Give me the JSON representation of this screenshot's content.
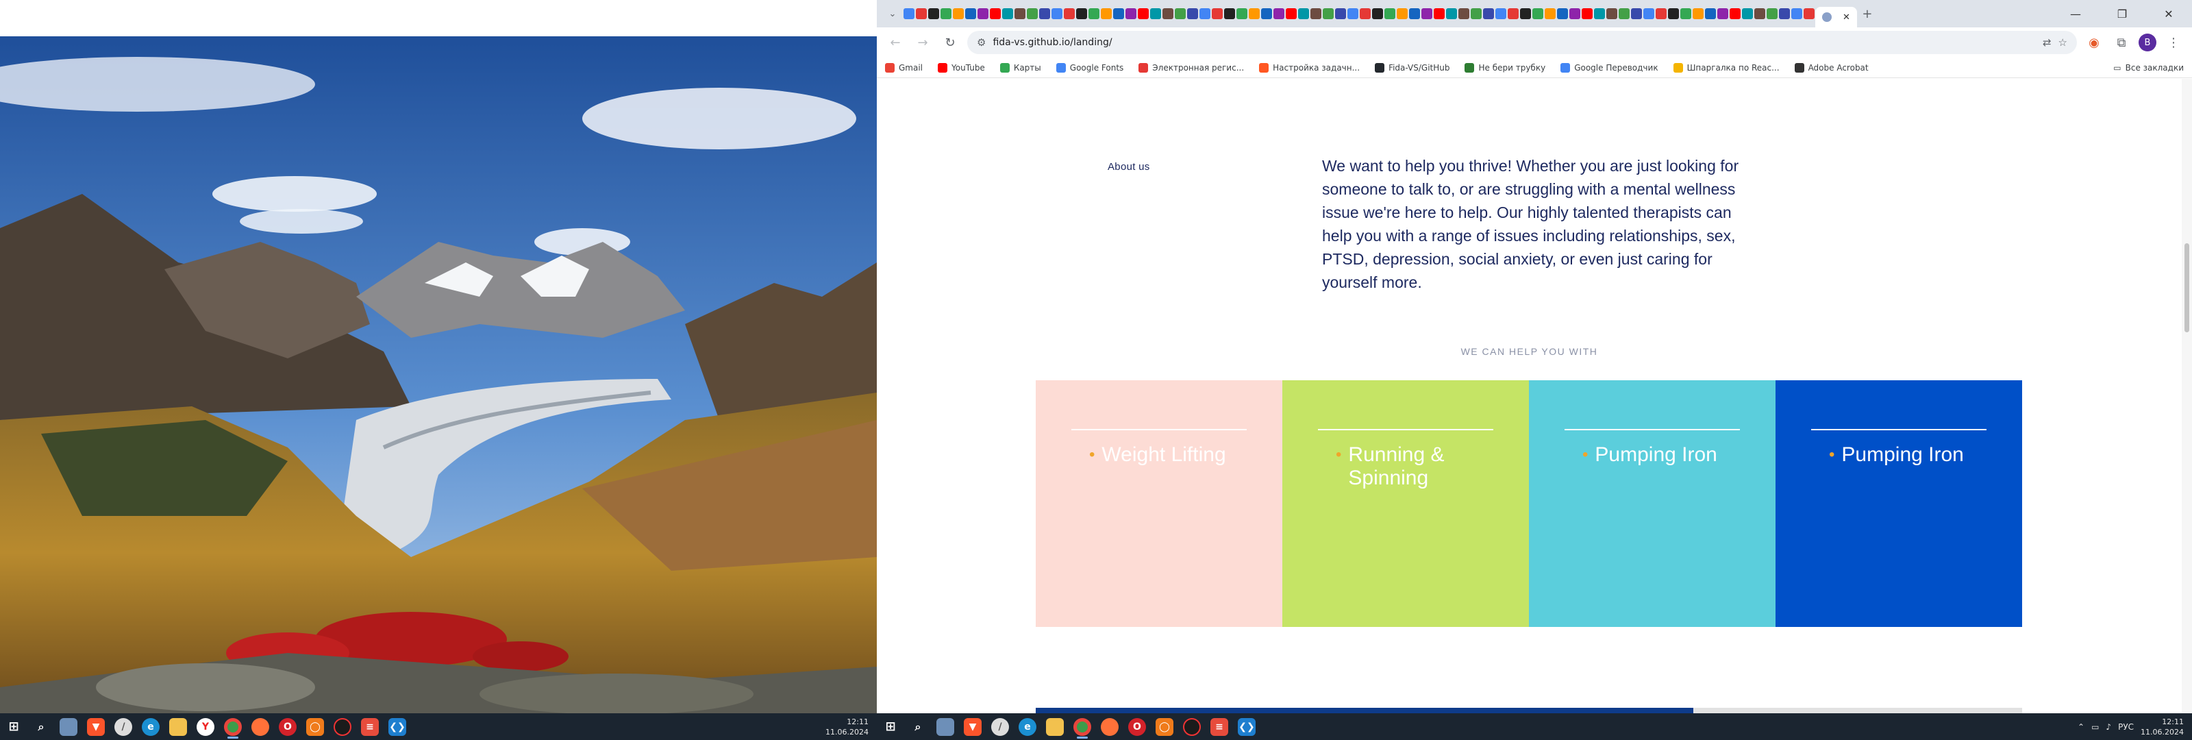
{
  "left_monitor": {
    "wallpaper": "mountain-glacier-landscape"
  },
  "browser": {
    "active_tab": {
      "title": ""
    },
    "window_controls": {
      "minimize": "—",
      "maximize": "❐",
      "close": "✕"
    },
    "toolbar": {
      "url": "fida-vs.github.io/landing/",
      "profile_initial": "B"
    },
    "bookmarks": [
      {
        "label": "Gmail",
        "color": "#ea4335"
      },
      {
        "label": "YouTube",
        "color": "#ff0000"
      },
      {
        "label": "Карты",
        "color": "#34a853"
      },
      {
        "label": "Google Fonts",
        "color": "#4285f4"
      },
      {
        "label": "Электронная регис...",
        "color": "#e53935"
      },
      {
        "label": "Настройка задачн...",
        "color": "#ff5722"
      },
      {
        "label": "Fida-VS/GitHub",
        "color": "#24292e"
      },
      {
        "label": "Не бери трубку",
        "color": "#2e7d32"
      },
      {
        "label": "Google Переводчик",
        "color": "#4285f4"
      },
      {
        "label": "Шпаргалка по Reac...",
        "color": "#f4b400"
      },
      {
        "label": "Adobe Acrobat",
        "color": "#333333"
      }
    ],
    "all_bookmarks_label": "Все закладки"
  },
  "page": {
    "about_label": "About us",
    "about_text": "We want to help you thrive! Whether you are just looking for someone to talk to, or are struggling with a mental wellness issue we're here to help. Our highly talented therapists can help you with a range of issues including relationships, sex, PTSD, depression, social anxiety, or even just caring for yourself more.",
    "help_heading": "WE CAN HELP YOU WITH",
    "cards": [
      {
        "label": "Weight Lifting",
        "color": "#fddcd5"
      },
      {
        "label": "Running & Spinning",
        "color": "#c5e465"
      },
      {
        "label": "Pumping Iron",
        "color": "#5bcedc"
      },
      {
        "label": "Pumping Iron",
        "color": "#0050c8"
      }
    ],
    "bullet_color": "#f0a52a"
  },
  "taskbar_left": {
    "clock_time": "12:11",
    "clock_date": "11.06.2024"
  },
  "taskbar_right": {
    "tray_lang": "РУС",
    "clock_time": "12:11",
    "clock_date": "11.06.2024"
  }
}
